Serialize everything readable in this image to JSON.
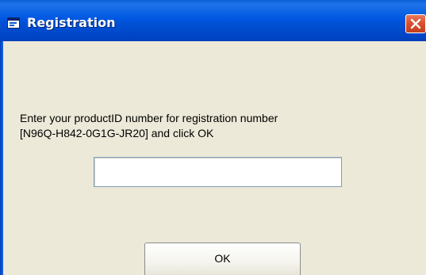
{
  "window": {
    "title": "Registration",
    "title_icon": "app-window-icon",
    "close_icon": "close-icon",
    "accent_color": "#0054E3",
    "close_color": "#D9522F",
    "background_color": "#ECE9D8"
  },
  "dialog": {
    "prompt_line1": "Enter your productID number for registration number",
    "prompt_line2": "[N96Q-H842-0G1G-JR20] and click OK",
    "product_id_value": "",
    "ok_label": "OK"
  }
}
